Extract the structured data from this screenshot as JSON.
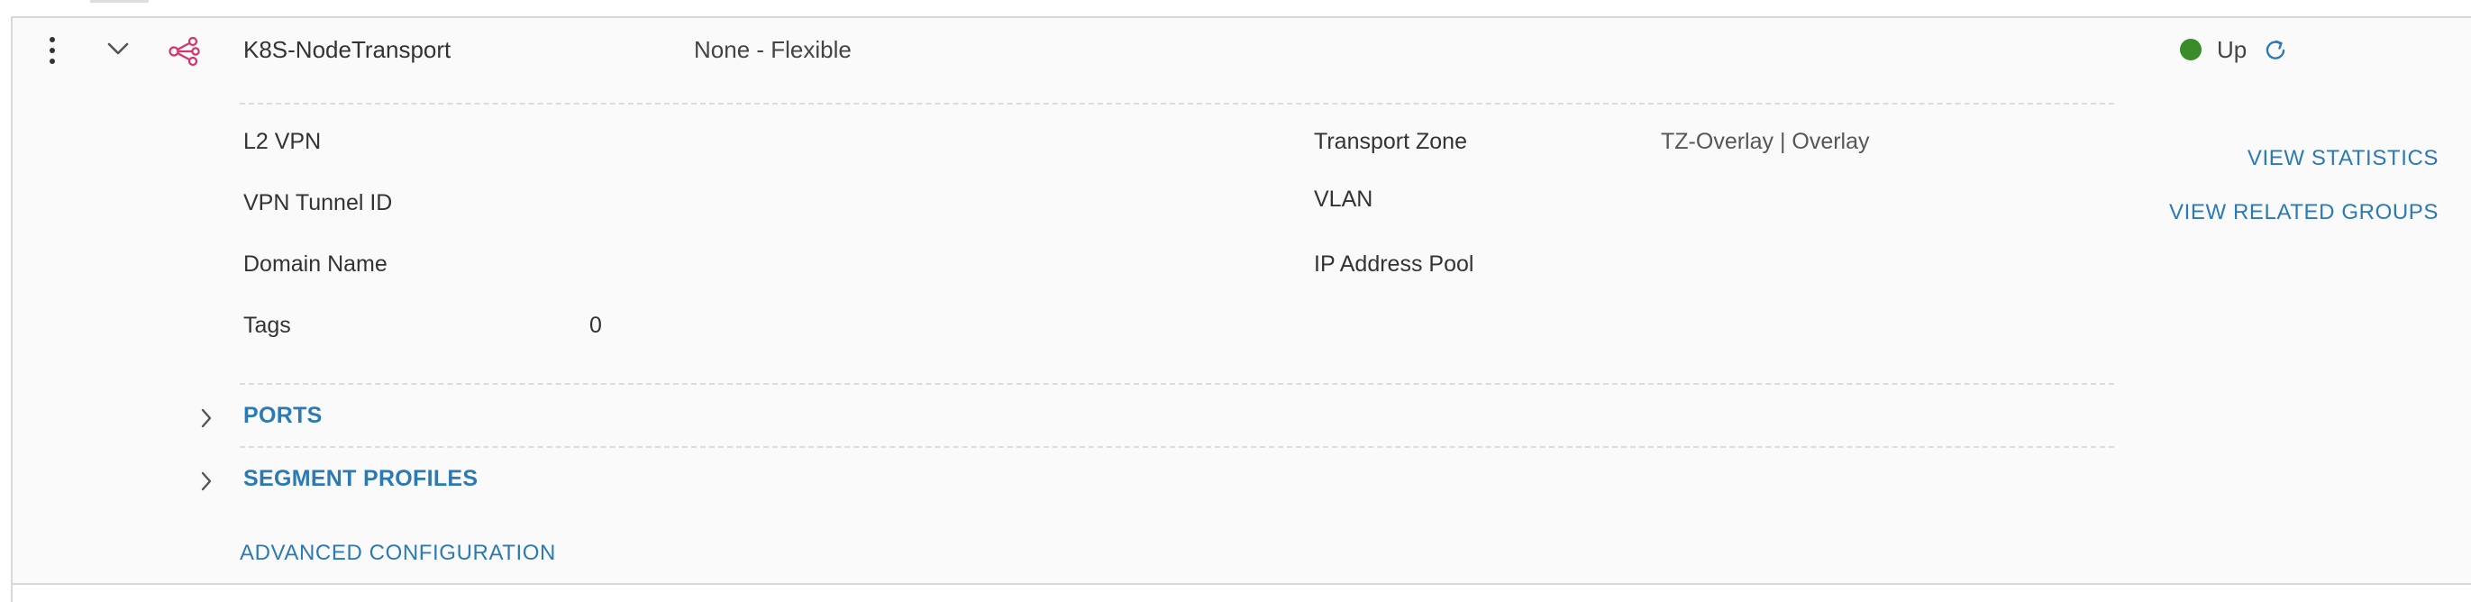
{
  "row": {
    "name": "K8S-NodeTransport",
    "connectivity": "None - Flexible",
    "status": "Up",
    "colors": {
      "status_up": "#3a8b2a",
      "link": "#2b7ab5",
      "segment_icon": "#d6336c"
    },
    "icons": {
      "actions": "kebab-menu-icon",
      "collapse": "chevron-down-icon",
      "segment": "segment-share-icon",
      "refresh": "refresh-icon"
    }
  },
  "details": {
    "left": [
      {
        "label": "L2 VPN",
        "value": ""
      },
      {
        "label": "VPN Tunnel ID",
        "value": ""
      },
      {
        "label": "Domain Name",
        "value": ""
      },
      {
        "label": "Tags",
        "value": "0"
      }
    ],
    "right": [
      {
        "label": "Transport Zone",
        "value": "TZ-Overlay | Overlay"
      },
      {
        "label": "VLAN",
        "value": ""
      },
      {
        "label": "IP Address Pool",
        "value": ""
      }
    ]
  },
  "actions": {
    "view_statistics": "VIEW STATISTICS",
    "view_related_groups": "VIEW RELATED GROUPS"
  },
  "sections": {
    "ports": "PORTS",
    "segment_profiles": "SEGMENT PROFILES",
    "advanced_configuration": "ADVANCED CONFIGURATION"
  }
}
